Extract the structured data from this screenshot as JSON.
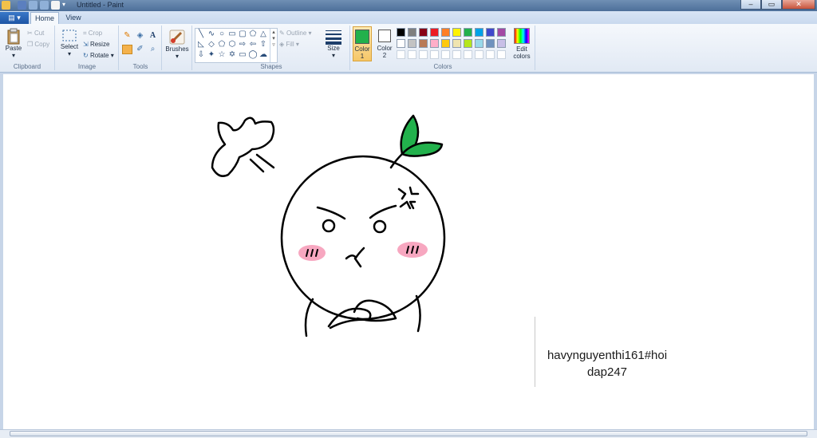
{
  "window": {
    "title": "Untitled - Paint",
    "minimize": "–",
    "maximize": "▭",
    "close": "✕"
  },
  "tabs": {
    "app_menu": "▤ ▾",
    "home": "Home",
    "view": "View"
  },
  "clipboard": {
    "paste": "Paste",
    "cut": "Cut",
    "copy": "Copy",
    "label": "Clipboard"
  },
  "image": {
    "select": "Select",
    "crop": "Crop",
    "resize": "Resize",
    "rotate": "Rotate",
    "label": "Image"
  },
  "tools": {
    "label": "Tools",
    "text_tool": "A"
  },
  "brushes": {
    "label": "Brushes"
  },
  "shapes": {
    "label": "Shapes",
    "outline": "Outline",
    "fill": "Fill"
  },
  "size": {
    "label": "Size"
  },
  "colors": {
    "label": "Colors",
    "color1_label": "Color\n1",
    "color1": "#22b14c",
    "color2_label": "Color\n2",
    "color2": "#ffffff",
    "edit": "Edit colors",
    "palette_row1": [
      "#000000",
      "#7f7f7f",
      "#880015",
      "#ed1c24",
      "#ff7f27",
      "#fff200",
      "#22b14c",
      "#00a2e8",
      "#3f48cc",
      "#a349a4"
    ],
    "palette_row2": [
      "#ffffff",
      "#c3c3c3",
      "#b97a57",
      "#ffaec9",
      "#ffc90e",
      "#efe4b0",
      "#b5e61d",
      "#99d9ea",
      "#7092be",
      "#c8bfe7"
    ]
  },
  "canvas": {
    "caption_line1": "havynguyenthi161#hoi",
    "caption_line2": "dap247"
  }
}
